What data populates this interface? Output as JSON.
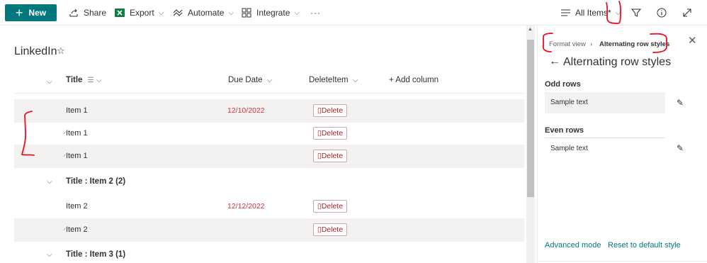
{
  "toolbar": {
    "new_label": "New",
    "share_label": "Share",
    "export_label": "Export",
    "automate_label": "Automate",
    "integrate_label": "Integrate",
    "more_label": "···",
    "view_label": "All Items*"
  },
  "list": {
    "title": "LinkedIn",
    "columns": [
      "Title",
      "Due Date",
      "DeleteItem",
      "+ Add column"
    ],
    "delete_label": "Delete",
    "group1_rows": [
      {
        "title": "Item 1",
        "due": "12/10/2022"
      },
      {
        "title": "Item 1",
        "due": ""
      },
      {
        "title": "Item 1",
        "due": ""
      }
    ],
    "group2_header": "Title : Item 2 (2)",
    "group2_rows": [
      {
        "title": "Item 2",
        "due": "12/12/2022"
      },
      {
        "title": "Item 2",
        "due": ""
      }
    ],
    "group3_header": "Title : Item 3 (1)"
  },
  "pane": {
    "crumb_parent": "Format view",
    "crumb_current": "Alternating row styles",
    "title": "Alternating row styles",
    "odd_label": "Odd rows",
    "odd_sample": "Sample text",
    "even_label": "Even rows",
    "even_sample": "Sample text",
    "advanced_link": "Advanced mode",
    "reset_link": "Reset to default style"
  },
  "colors": {
    "accent": "#03787c",
    "date": "#d13438",
    "annotation": "#e81123"
  }
}
